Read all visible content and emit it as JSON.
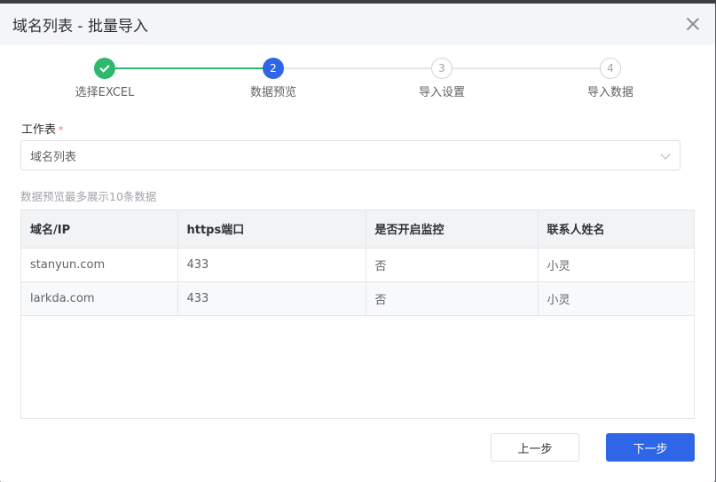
{
  "dialog": {
    "title": "域名列表 - 批量导入"
  },
  "steps": [
    {
      "number": "1",
      "label": "选择EXCEL",
      "state": "done"
    },
    {
      "number": "2",
      "label": "数据预览",
      "state": "active"
    },
    {
      "number": "3",
      "label": "导入设置",
      "state": "todo"
    },
    {
      "number": "4",
      "label": "导入数据",
      "state": "todo"
    }
  ],
  "form": {
    "sheet_label": "工作表",
    "required_mark": "*",
    "sheet_value": "域名列表",
    "hint": "数据预览最多展示10条数据"
  },
  "table": {
    "columns": [
      "域名/IP",
      "https端口",
      "是否开启监控",
      "联系人姓名"
    ],
    "rows": [
      [
        "stanyun.com",
        "433",
        "否",
        "小灵"
      ],
      [
        "larkda.com",
        "433",
        "否",
        "小灵"
      ]
    ]
  },
  "buttons": {
    "prev_label": "上一步",
    "next_label": "下一步"
  },
  "colors": {
    "primary": "#2f66e8",
    "success": "#2db86d",
    "required": "#f56c6c"
  }
}
